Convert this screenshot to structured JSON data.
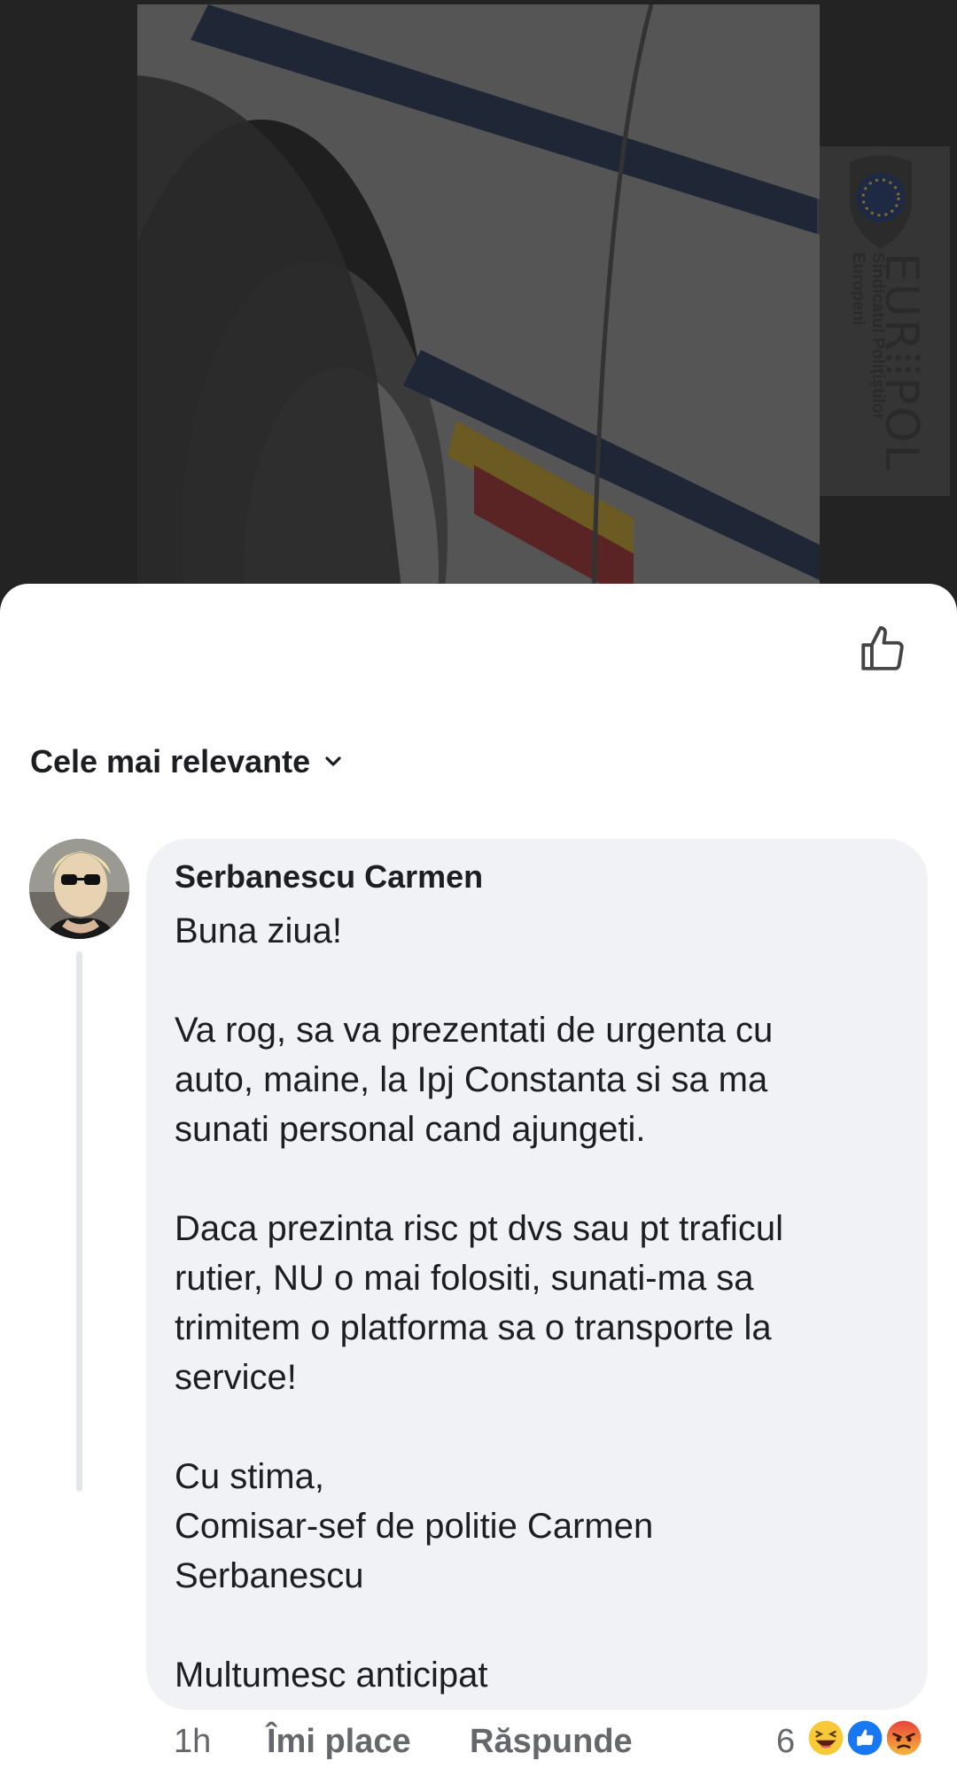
{
  "watermark": {
    "brand_text": "EUR⦙⦙POL",
    "subtitle": "Sindicatul Poliţiştilor Europeni"
  },
  "comments": {
    "sort_label": "Cele mai relevante",
    "items": [
      {
        "author": "Serbanescu Carmen",
        "paragraphs": [
          [
            "Buna ziua!"
          ],
          [
            "Va rog, sa va prezentati de urgenta cu",
            "auto, maine, la Ipj Constanta si sa ma",
            "sunati personal cand ajungeti."
          ],
          [
            "Daca prezinta risc pt dvs sau pt traficul",
            "rutier, NU o mai folositi, sunati-ma sa",
            "trimitem o platforma sa o transporte la",
            "service!"
          ],
          [
            "Cu stima,",
            "Comisar-sef de politie Carmen",
            "Serbanescu"
          ],
          [
            "Multumesc anticipat"
          ]
        ],
        "time": "1h",
        "like_label": "Îmi place",
        "reply_label": "Răspunde",
        "reaction_count": "6",
        "reactions": [
          "haha-icon",
          "like-icon",
          "angry-icon"
        ]
      }
    ]
  },
  "colors": {
    "sheet_bg": "#ffffff",
    "bubble_bg": "#f0f2f5",
    "text_primary": "#1c1e21",
    "text_secondary": "#65676b",
    "like_blue": "#1877f2"
  }
}
